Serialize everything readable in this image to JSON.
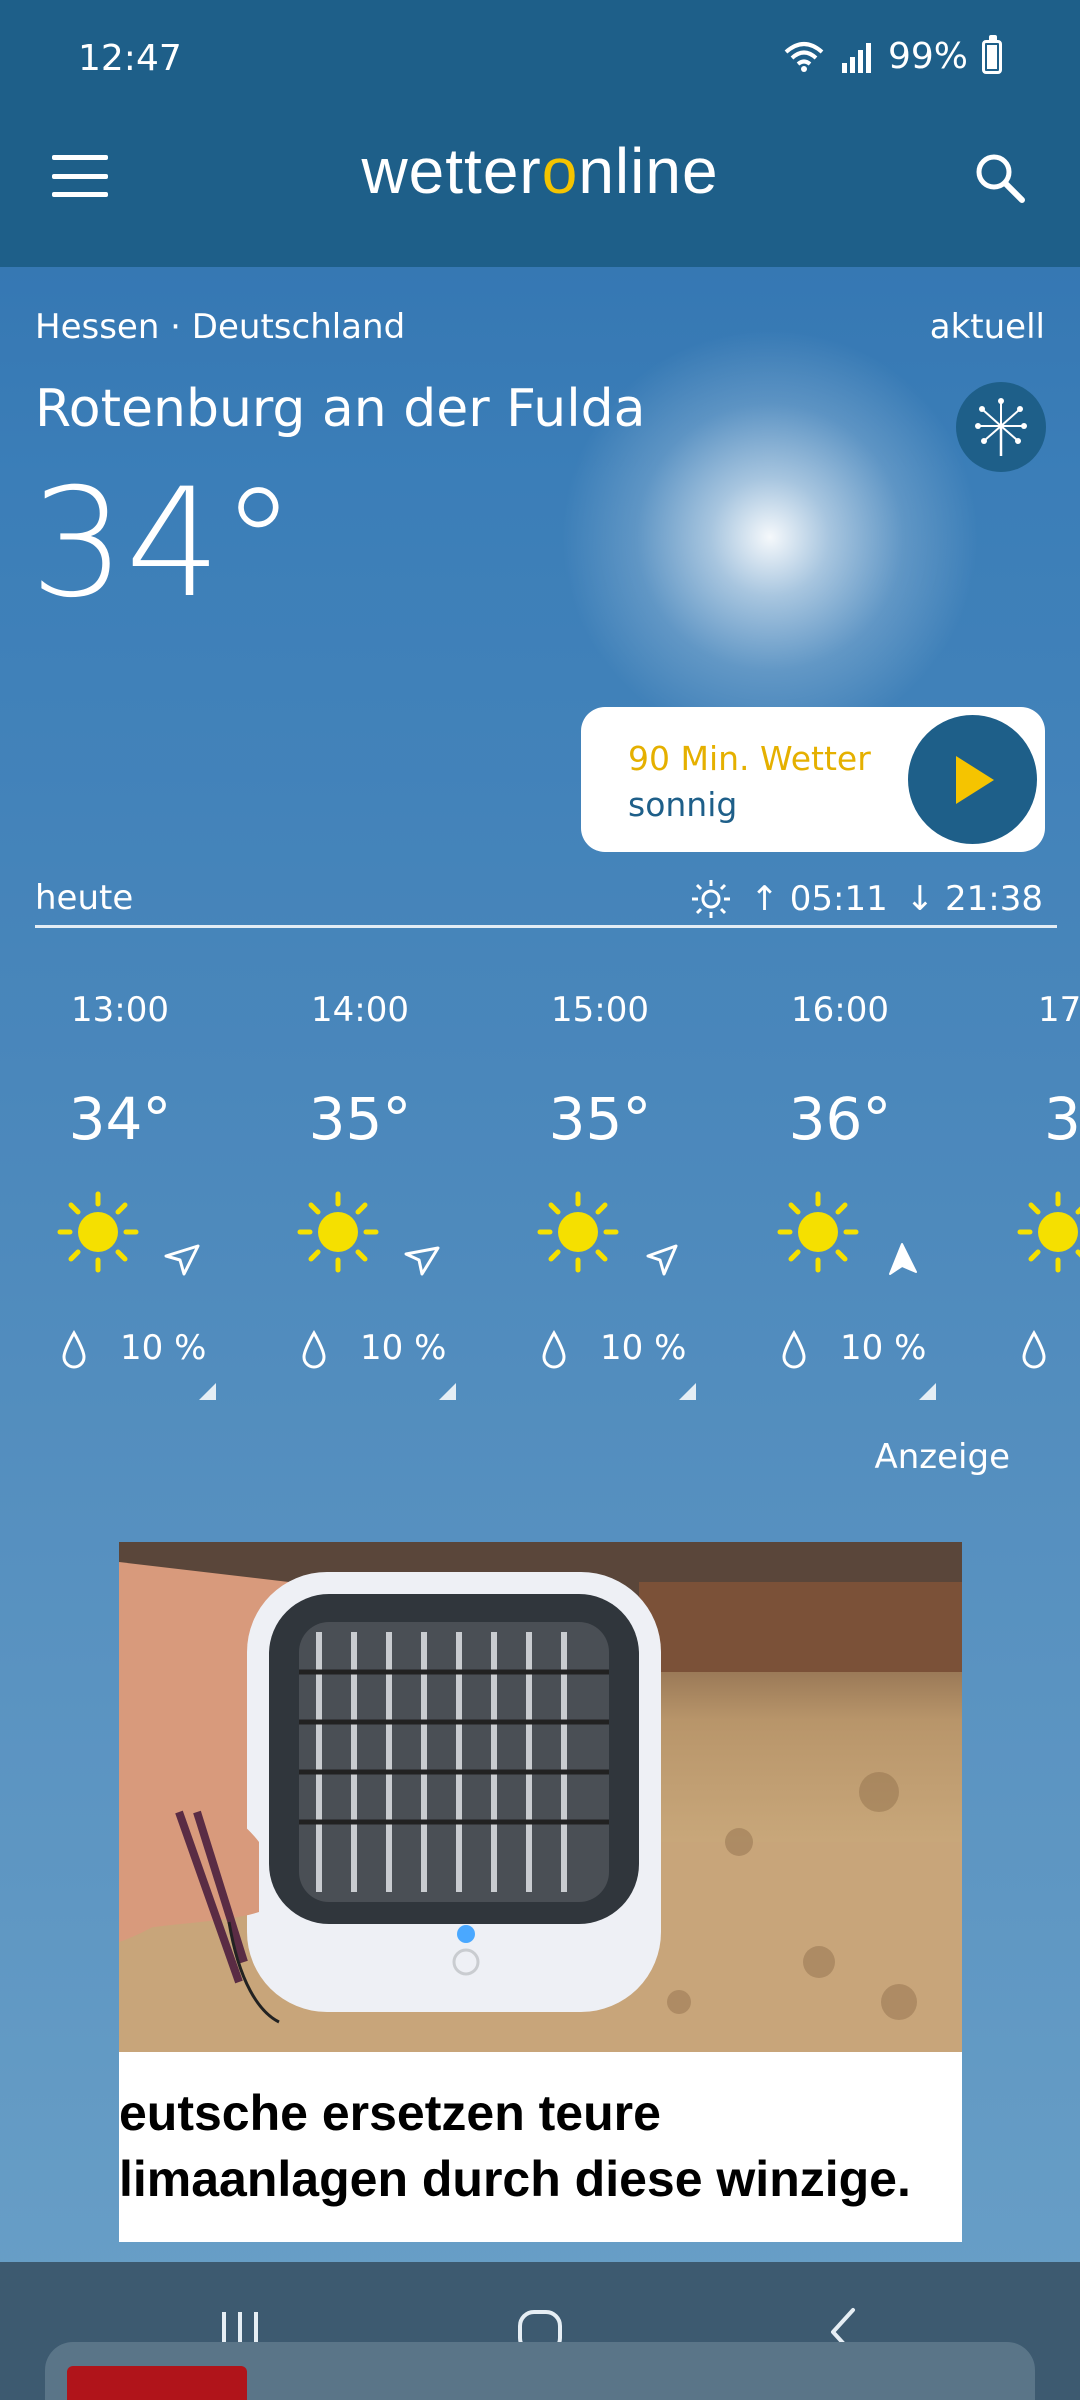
{
  "status_bar": {
    "time": "12:47",
    "battery": "99%"
  },
  "header": {
    "logo_pre": "wetter",
    "logo_o": "o",
    "logo_post": "nline"
  },
  "location": {
    "region": "Hessen · Deutschland",
    "mode": "aktuell",
    "city": "Rotenburg an der Fulda",
    "temperature": "34°"
  },
  "nowcast": {
    "line1": "90 Min. Wetter",
    "line2": "sonnig"
  },
  "today": {
    "label": "heute",
    "sunrise": "05:11",
    "sunset": "21:38"
  },
  "hourly": [
    {
      "time": "13:00",
      "temp": "34°",
      "precip": "10 %"
    },
    {
      "time": "14:00",
      "temp": "35°",
      "precip": "10 %"
    },
    {
      "time": "15:00",
      "temp": "35°",
      "precip": "10 %"
    },
    {
      "time": "16:00",
      "temp": "36°",
      "precip": "10 %"
    },
    {
      "time": "17:",
      "temp": "3",
      "precip": ""
    }
  ],
  "ad": {
    "label": "Anzeige",
    "line1": "eutsche ersetzen teure",
    "line2": "limaanlagen durch diese winzige."
  },
  "colors": {
    "header": "#1e5f89",
    "accent": "#f5c400",
    "sun": "#f5e000"
  }
}
